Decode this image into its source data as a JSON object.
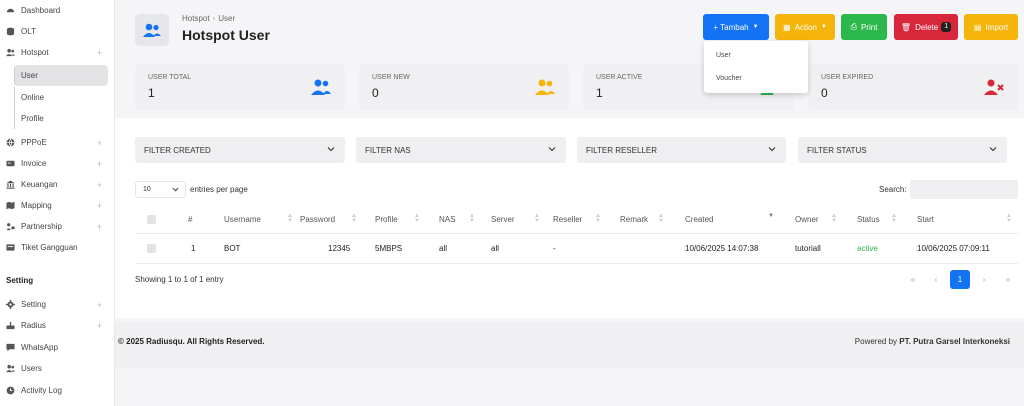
{
  "colors": {
    "tambah": "#1472f5",
    "action": "#f5b40a",
    "print": "#2cb84c",
    "delete": "#d8263b",
    "import": "#f5b40a",
    "active_status": "#2cb84c",
    "pager_active": "#1472f5"
  },
  "sidebar": {
    "items": [
      {
        "label": "Dashboard",
        "icon": "gauge-icon"
      },
      {
        "label": "OLT",
        "icon": "database-icon"
      },
      {
        "label": "Hotspot",
        "icon": "users-icon",
        "expandable": true
      },
      {
        "label": "PPPoE",
        "icon": "globe-icon",
        "expandable": true
      },
      {
        "label": "Invoice",
        "icon": "invoice-icon",
        "expandable": true
      },
      {
        "label": "Keuangan",
        "icon": "bank-icon",
        "expandable": true
      },
      {
        "label": "Mapping",
        "icon": "map-icon",
        "expandable": true
      },
      {
        "label": "Partnership",
        "icon": "handshake-icon",
        "expandable": true
      },
      {
        "label": "Tiket Gangguan",
        "icon": "ticket-icon"
      }
    ],
    "hotspot_sub": [
      {
        "label": "User",
        "active": true
      },
      {
        "label": "Online"
      },
      {
        "label": "Profile"
      }
    ],
    "section_setting": "Setting",
    "setting_items": [
      {
        "label": "Setting",
        "icon": "gear-icon",
        "expandable": true
      },
      {
        "label": "Radius",
        "icon": "server-icon",
        "expandable": true
      },
      {
        "label": "WhatsApp",
        "icon": "chat-icon"
      },
      {
        "label": "Users",
        "icon": "users-icon"
      },
      {
        "label": "Activity Log",
        "icon": "clock-icon"
      }
    ]
  },
  "header": {
    "breadcrumb": [
      "Hotspot",
      "User"
    ],
    "title": "Hotspot User"
  },
  "toolbar": {
    "tambah": "+ Tambah",
    "action": "Action",
    "print": "Print",
    "delete": "Delete",
    "delete_count": "1",
    "import": "Import"
  },
  "tambah_menu": [
    "User",
    "Voucher"
  ],
  "stats": [
    {
      "label": "USER TOTAL",
      "value": "1",
      "icon": "users-icon",
      "color": "#1472f5"
    },
    {
      "label": "USER NEW",
      "value": "0",
      "icon": "users-icon",
      "color": "#f5b40a"
    },
    {
      "label": "USER ACTIVE",
      "value": "1",
      "icon": "user-check-icon",
      "color": "#2cb84c"
    },
    {
      "label": "USER EXPIRED",
      "value": "0",
      "icon": "user-x-icon",
      "color": "#d8263b"
    }
  ],
  "filters": [
    "FILTER CREATED",
    "FILTER NAS",
    "FILTER RESELLER",
    "FILTER STATUS"
  ],
  "table": {
    "page_length": "10",
    "entries_label": "entries per page",
    "search_label": "Search:",
    "search_value": "",
    "columns": [
      "#",
      "Username",
      "Password",
      "Profile",
      "NAS",
      "Server",
      "Reseller",
      "Remark",
      "Created",
      "Owner",
      "Status",
      "Start"
    ],
    "rows": [
      {
        "no": "1",
        "username": "BOT",
        "password": "12345",
        "profile": "5MBPS",
        "nas": "all",
        "server": "all",
        "reseller": "-",
        "remark": "",
        "created": "10/06/2025 14:07:38",
        "owner": "tutoriall",
        "status": "active",
        "start": "10/06/2025 07:09:11"
      }
    ],
    "info": "Showing 1 to 1 of 1 entry",
    "pager": {
      "first": "«",
      "prev": "‹",
      "current": "1",
      "next": "›",
      "last": "»"
    }
  },
  "footer": {
    "copyright": "© 2025 Radiusqu. All Rights Reserved.",
    "powered_prefix": "Powered by",
    "powered_company": "PT. Putra Garsel Interkoneksi"
  }
}
